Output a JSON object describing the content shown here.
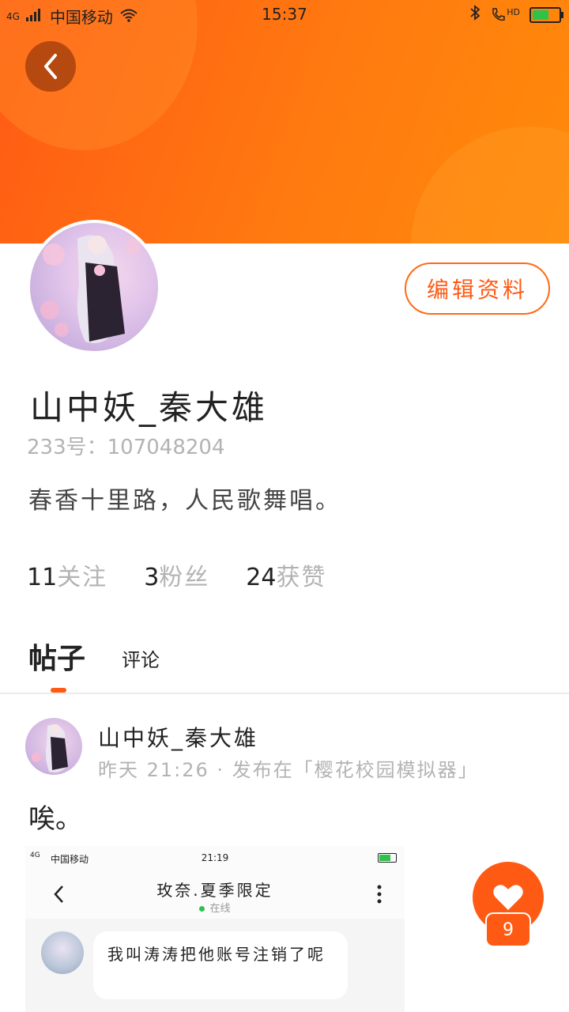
{
  "status_bar": {
    "network": "4G",
    "carrier": "中国移动",
    "time": "15:37",
    "hd": "HD"
  },
  "profile": {
    "username": "山中妖_秦大雄",
    "uid": "233号：107048204",
    "bio": "春香十里路，人民歌舞唱。",
    "edit_label": "编辑资料"
  },
  "stats": [
    {
      "num": "11",
      "label": "关注"
    },
    {
      "num": "3",
      "label": "粉丝"
    },
    {
      "num": "24",
      "label": "获赞"
    }
  ],
  "tabs": {
    "active": "帖子",
    "other": "评论"
  },
  "post": {
    "author": "山中妖_秦大雄",
    "meta": "昨天 21:26 · 发布在「樱花校园模拟器」",
    "text": "唉。",
    "like_count": "9",
    "screenshot": {
      "status_carrier": "中国移动",
      "status_network": "4G",
      "status_time": "21:19",
      "chat_title": "玫奈.夏季限定",
      "online": "在线",
      "message": "我叫涛涛把他账号注销了呢"
    }
  },
  "colors": {
    "accent": "#ff5a14",
    "header_gradient_start": "#ff5a14",
    "header_gradient_end": "#ff8a0a",
    "muted_text": "#b3b3b3"
  },
  "icons": [
    "back-arrow-icon",
    "signal-icon",
    "wifi-icon",
    "bluetooth-icon",
    "call-hd-icon",
    "battery-icon",
    "heart-icon",
    "more-vertical-icon"
  ]
}
